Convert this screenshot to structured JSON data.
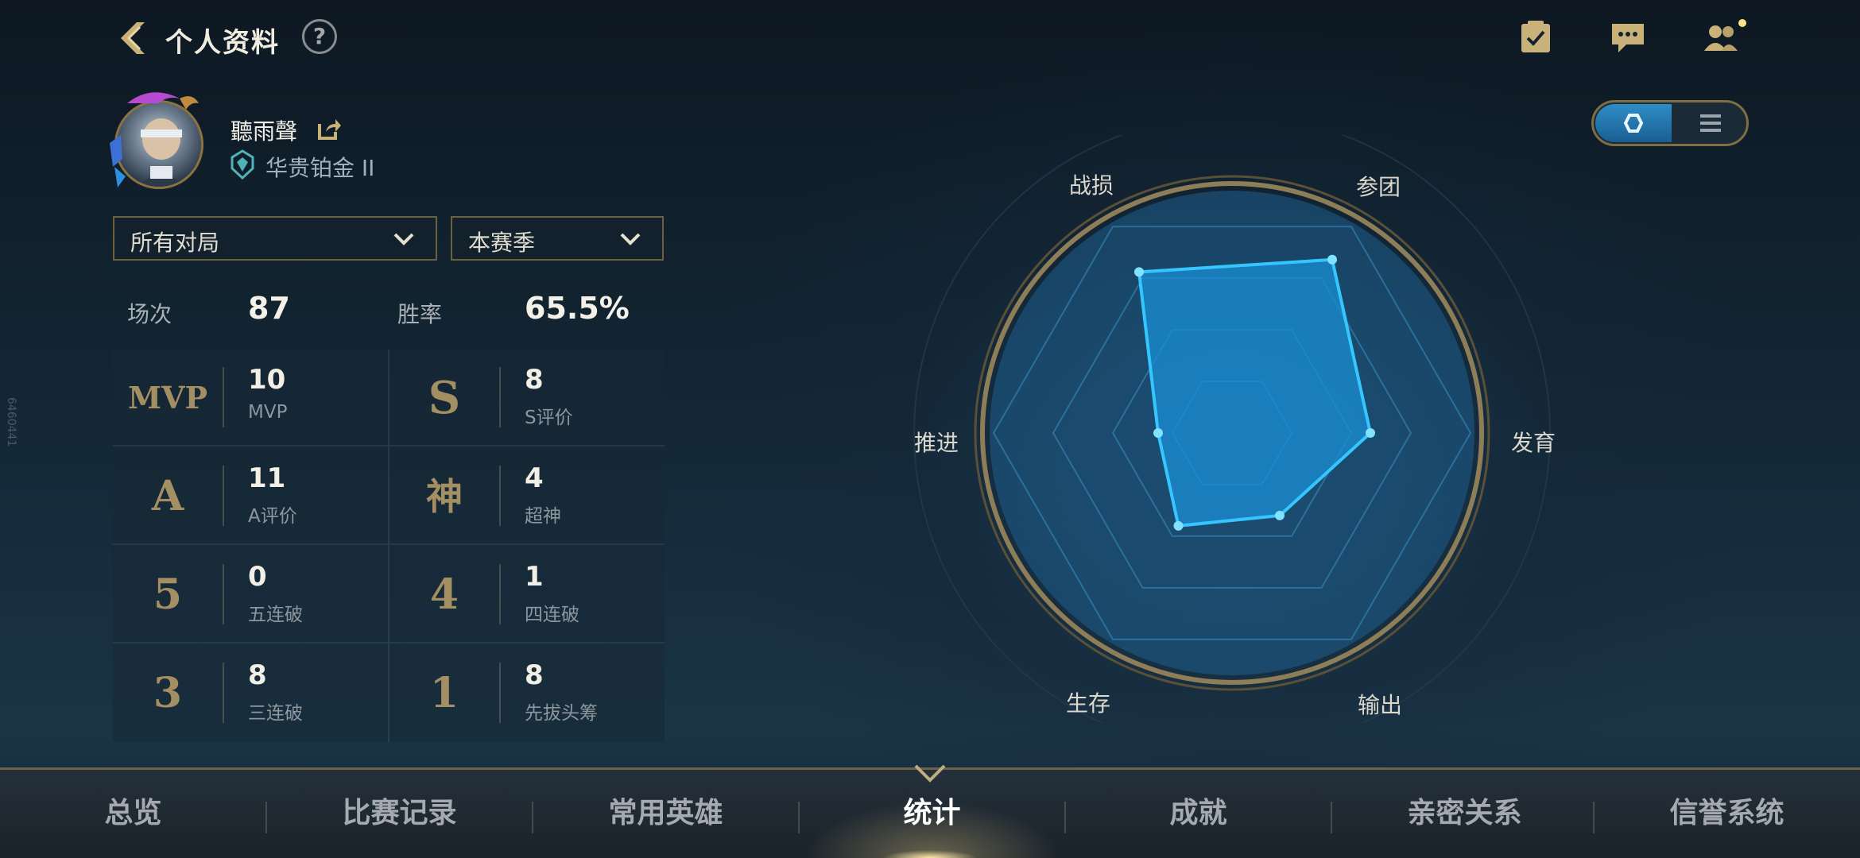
{
  "header": {
    "title": "个人资料",
    "help_glyph": "?",
    "icons": [
      "back-icon",
      "help-icon",
      "task-list-icon",
      "chat-icon",
      "friends-icon"
    ]
  },
  "profile": {
    "username": "聽雨聲",
    "rank": "华贵铂金 II"
  },
  "filters": {
    "mode": "所有对局",
    "season": "本赛季"
  },
  "summary": {
    "games_label": "场次",
    "games_value": "87",
    "winrate_label": "胜率",
    "winrate_value": "65.5%"
  },
  "stats": [
    {
      "badge": "MVP",
      "value": "10",
      "caption": "MVP"
    },
    {
      "badge": "S",
      "value": "8",
      "caption": "S评价"
    },
    {
      "badge": "A",
      "value": "11",
      "caption": "A评价"
    },
    {
      "badge": "神",
      "value": "4",
      "caption": "超神"
    },
    {
      "badge": "5",
      "value": "0",
      "caption": "五连破"
    },
    {
      "badge": "4",
      "value": "1",
      "caption": "四连破"
    },
    {
      "badge": "3",
      "value": "8",
      "caption": "三连破"
    },
    {
      "badge": "1",
      "value": "8",
      "caption": "先拔头筹"
    }
  ],
  "view_toggle": {
    "active": "radar"
  },
  "radar": {
    "axes": [
      "战损",
      "参团",
      "发育",
      "输出",
      "生存",
      "推进"
    ],
    "values": [
      0.78,
      0.84,
      0.58,
      0.4,
      0.45,
      0.31
    ],
    "colors": {
      "fill": "#1a8fd4",
      "stroke": "#35c6ff",
      "ring": "#b9a67a"
    }
  },
  "side_tag": "6460441",
  "nav": {
    "items": [
      "总览",
      "比赛记录",
      "常用英雄",
      "统计",
      "成就",
      "亲密关系",
      "信誉系统"
    ],
    "active_index": 3
  }
}
